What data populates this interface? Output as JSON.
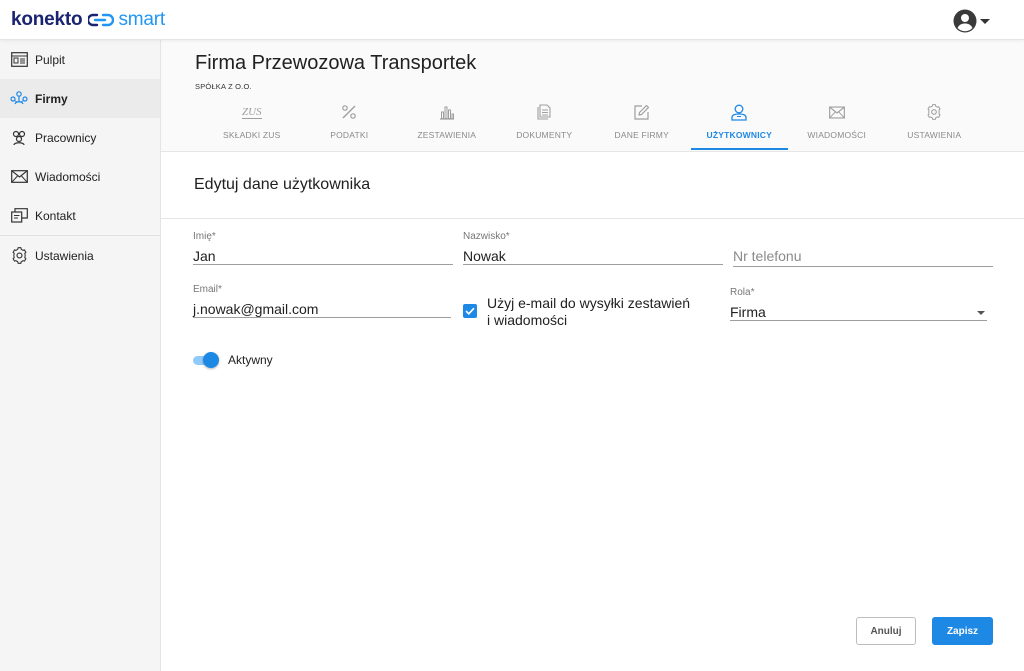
{
  "brand": {
    "part1": "konekto",
    "part2": "smart",
    "color_primary": "#1a2470",
    "color_accent": "#2196f3"
  },
  "account": {
    "icon": "account-circle-icon"
  },
  "sidebar": {
    "items": [
      {
        "label": "Pulpit",
        "icon": "dashboard-icon",
        "active": false
      },
      {
        "label": "Firmy",
        "icon": "companies-icon",
        "active": true
      },
      {
        "label": "Pracownicy",
        "icon": "employees-icon",
        "active": false
      },
      {
        "label": "Wiadomości",
        "icon": "envelope-icon",
        "active": false
      },
      {
        "label": "Kontakt",
        "icon": "contact-icon",
        "active": false
      },
      {
        "label": "Ustawienia",
        "icon": "gear-icon",
        "active": false
      }
    ]
  },
  "company": {
    "title": "Firma Przewozowa Transportek",
    "subtitle": "SPÓŁKA Z O.O."
  },
  "tabs": [
    {
      "label": "SKŁADKI ZUS",
      "icon": "zus-icon",
      "active": false
    },
    {
      "label": "PODATKI",
      "icon": "percent-icon",
      "active": false
    },
    {
      "label": "ZESTAWIENIA",
      "icon": "bar-chart-icon",
      "active": false
    },
    {
      "label": "DOKUMENTY",
      "icon": "documents-icon",
      "active": false
    },
    {
      "label": "DANE FIRMY",
      "icon": "edit-icon",
      "active": false
    },
    {
      "label": "UŻYTKOWNICY",
      "icon": "user-icon",
      "active": true
    },
    {
      "label": "WIADOMOŚCI",
      "icon": "envelope-icon",
      "active": false
    },
    {
      "label": "USTAWIENIA",
      "icon": "gear-icon",
      "active": false
    }
  ],
  "form": {
    "title": "Edytuj dane użytkownika",
    "first_name": {
      "label": "Imię*",
      "value": "Jan"
    },
    "last_name": {
      "label": "Nazwisko*",
      "value": "Nowak"
    },
    "phone": {
      "placeholder": "Nr telefonu",
      "value": ""
    },
    "email": {
      "label": "Email*",
      "value": "j.nowak@gmail.com"
    },
    "use_email": {
      "label_line1": "Użyj e-mail do wysyłki zestawień",
      "label_line2": "i wiadomości",
      "checked": true
    },
    "role": {
      "label": "Rola*",
      "value": "Firma"
    },
    "active": {
      "label": "Aktywny",
      "on": true
    }
  },
  "buttons": {
    "cancel": "Anuluj",
    "save": "Zapisz"
  },
  "zus_icon_text": "ZUS",
  "colors": {
    "accent": "#1e88e5",
    "tab_inactive": "#8a8a8a"
  }
}
